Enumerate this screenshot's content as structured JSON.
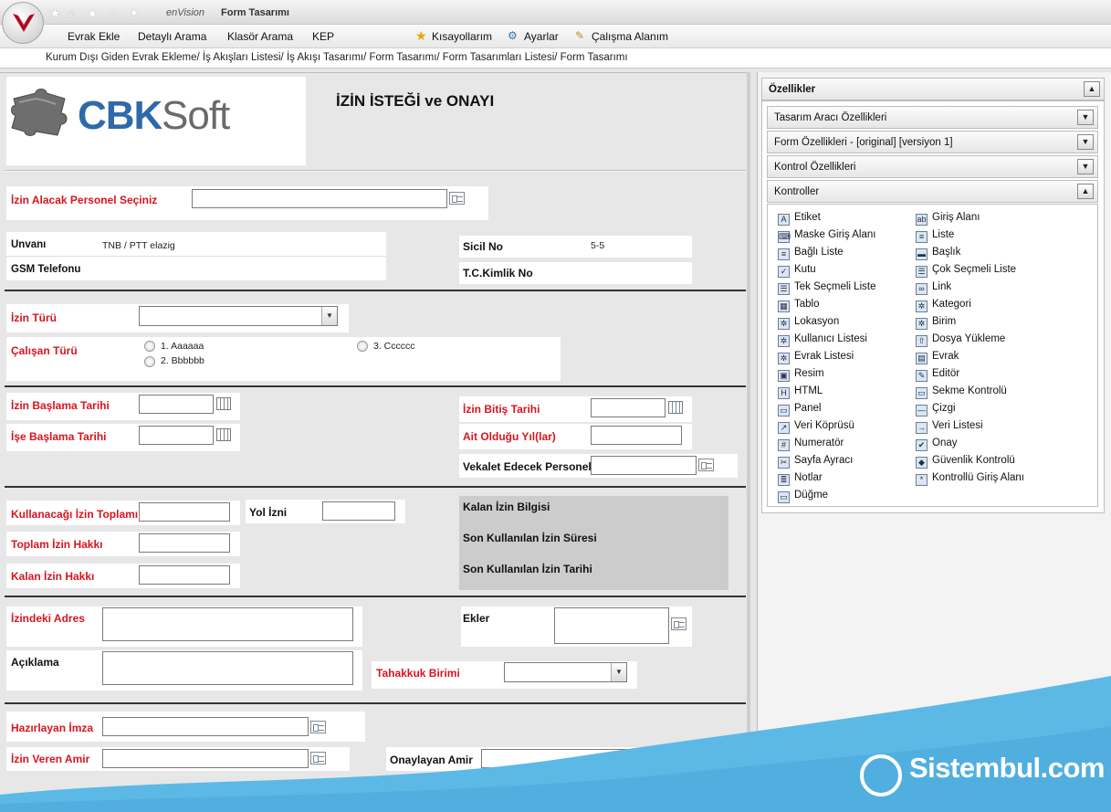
{
  "window": {
    "brand": "enVision",
    "title": "Form Tasarımı"
  },
  "menu": {
    "items": [
      "Evrak Ekle",
      "Detaylı Arama",
      "Klasör Arama",
      "KEP"
    ],
    "shortcuts": "Kısayollarım",
    "settings": "Ayarlar",
    "workspace": "Çalışma Alanım"
  },
  "breadcrumb": "Kurum Dışı Giden Evrak Ekleme/ İş Akışları Listesi/ İş Akışı Tasarımı/ Form Tasarımı/ Form Tasarımları Listesi/ Form Tasarımı",
  "form": {
    "logo_text_a": "CBK",
    "logo_text_b": "Soft",
    "title": "İZİN İSTEĞİ ve ONAYI",
    "personel_label": "İzin Alacak Personel Seçiniz",
    "unvan_label": "Unvanı",
    "unvan_value": "TNB / PTT elazig",
    "gsm_label": "GSM Telefonu",
    "sicil_label": "Sicil No",
    "sicil_value": "5-5",
    "tc_label": "T.C.Kimlik No",
    "izin_turu_label": "İzin Türü",
    "calisan_turu_label": "Çalışan Türü",
    "radio_options": [
      "1. Aaaaaa",
      "2. Bbbbbb",
      "3. Cccccc"
    ],
    "baslama_label": "İzin Başlama Tarihi",
    "ise_baslama_label": "İşe Başlama Tarihi",
    "bitis_label": "İzin Bitiş Tarihi",
    "ait_label": "Ait Olduğu Yıl(lar)",
    "vekalet_label": "Vekalet Edecek Personel",
    "kullanacagi_label": "Kullanacağı İzin Toplamı",
    "yol_label": "Yol İzni",
    "toplam_label": "Toplam İzin Hakkı",
    "kalan_label": "Kalan İzin Hakkı",
    "kalan_bilgi_label": "Kalan İzin Bilgisi",
    "son_sure_label": "Son Kullanılan İzin Süresi",
    "son_tarih_label": "Son Kullanılan İzin Tarihi",
    "adres_label": "İzindeki Adres",
    "ekler_label": "Ekler",
    "aciklama_label": "Açıklama",
    "tahakkuk_label": "Tahakkuk Birimi",
    "hazirlayan_label": "Hazırlayan İmza",
    "veren_label": "İzin Veren Amir",
    "onaylayan_label": "Onaylayan Amir"
  },
  "panel": {
    "header": "Özellikler",
    "sections": [
      "Tasarım Aracı Özellikleri",
      "Form Özellikleri - [original] [versiyon 1]",
      "Kontrol Özellikleri",
      "Kontroller"
    ],
    "controls_left": [
      "Etiket",
      "Maske Giriş Alanı",
      "Bağlı Liste",
      "Kutu",
      "Tek Seçmeli Liste",
      "Tablo",
      "Lokasyon",
      "Kullanıcı Listesi",
      "Evrak Listesi",
      "Resim",
      "HTML",
      "Panel",
      "Veri Köprüsü",
      "Numeratör",
      "Sayfa Ayracı",
      "Notlar",
      "Düğme"
    ],
    "controls_right": [
      "Giriş Alanı",
      "Liste",
      "Başlık",
      "Çok Seçmeli Liste",
      "Link",
      "Kategori",
      "Birim",
      "Dosya Yükleme",
      "Evrak",
      "Editör",
      "Sekme Kontrolü",
      "Çizgi",
      "Veri Listesi",
      "Onay",
      "Güvenlik Kontrolü",
      "Kontrollü Giriş Alanı"
    ]
  },
  "watermark": "Sistembul.com",
  "colors": {
    "required_label": "#d8141e",
    "watermark_blue": "#5cb9e6"
  }
}
